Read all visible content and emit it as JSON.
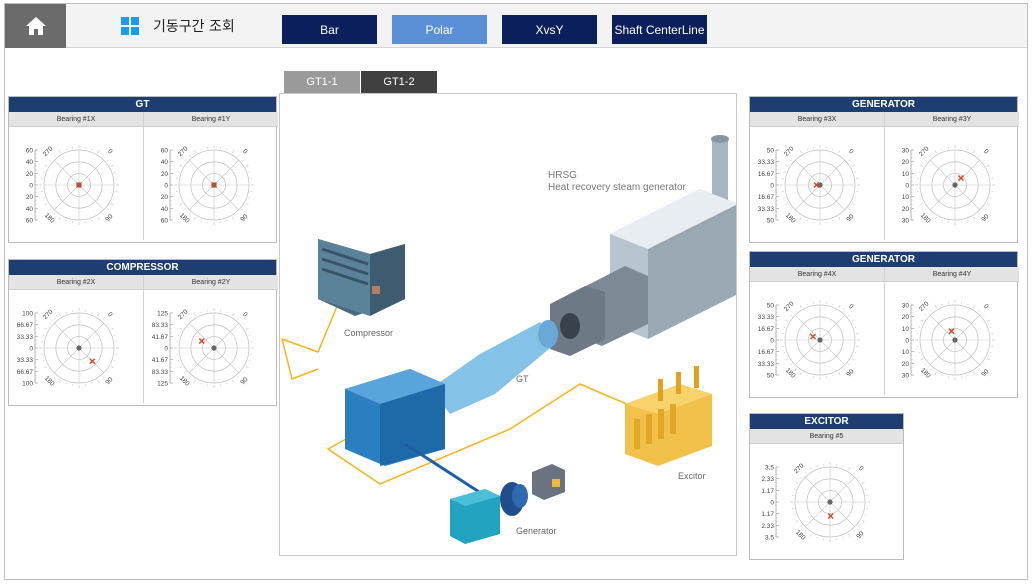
{
  "header": {
    "title": "기동구간 조회",
    "nav": [
      {
        "label": "Bar",
        "active": false
      },
      {
        "label": "Polar",
        "active": true
      },
      {
        "label": "XvsY",
        "active": false
      },
      {
        "label": "Shaft CenterLine",
        "active": false
      }
    ]
  },
  "tabs": [
    {
      "label": "GT1-1",
      "active": false
    },
    {
      "label": "GT1-2",
      "active": true
    }
  ],
  "diagram": {
    "hrsg_label": "HRSG",
    "hrsg_sub": "Heat recovery steam generator",
    "compressor_label": "Compressor",
    "gt_label": "GT",
    "excitor_label": "Excitor",
    "generator_label": "Generator"
  },
  "panels": {
    "gt": {
      "title": "GT",
      "bearings": [
        {
          "label": "Bearing #1X",
          "axis": [
            "60",
            "40",
            "20",
            "0",
            "20",
            "40",
            "60"
          ],
          "marker": [
            0.0,
            0.0
          ]
        },
        {
          "label": "Bearing #1Y",
          "axis": [
            "60",
            "40",
            "20",
            "0",
            "20",
            "40",
            "60"
          ],
          "marker": [
            0.0,
            0.0
          ]
        }
      ]
    },
    "compressor": {
      "title": "COMPRESSOR",
      "bearings": [
        {
          "label": "Bearing #2X",
          "axis": [
            "100",
            "66.67",
            "33.33",
            "0",
            "33.33",
            "66.67",
            "100"
          ],
          "marker": [
            0.38,
            0.38
          ]
        },
        {
          "label": "Bearing #2Y",
          "axis": [
            "125",
            "83.33",
            "41.67",
            "0",
            "41.67",
            "83.33",
            "125"
          ],
          "marker": [
            -0.35,
            -0.2
          ]
        }
      ]
    },
    "generator1": {
      "title": "GENERATOR",
      "bearings": [
        {
          "label": "Bearing #3X",
          "axis": [
            "50",
            "33.33",
            "16.67",
            "0",
            "16.67",
            "33.33",
            "50"
          ],
          "marker": [
            -0.1,
            0.0
          ]
        },
        {
          "label": "Bearing #3Y",
          "axis": [
            "30",
            "20",
            "10",
            "0",
            "10",
            "20",
            "30"
          ],
          "marker": [
            0.17,
            -0.2
          ]
        }
      ]
    },
    "generator2": {
      "title": "GENERATOR",
      "bearings": [
        {
          "label": "Bearing #4X",
          "axis": [
            "50",
            "33.33",
            "16.67",
            "0",
            "16.67",
            "33.33",
            "50"
          ],
          "marker": [
            -0.2,
            -0.1
          ]
        },
        {
          "label": "Bearing #4Y",
          "axis": [
            "30",
            "20",
            "10",
            "0",
            "10",
            "20",
            "30"
          ],
          "marker": [
            -0.1,
            -0.25
          ]
        }
      ]
    },
    "excitor": {
      "title": "EXCITOR",
      "bearings": [
        {
          "label": "Bearing #5",
          "axis": [
            "3.5",
            "2.33",
            "1.17",
            "0",
            "1.17",
            "2.33",
            "3.5"
          ],
          "marker": [
            0.02,
            0.4
          ]
        }
      ]
    }
  },
  "polar_labels": {
    "top": "0",
    "left": "270",
    "right": "90",
    "bottom_left": "180",
    "bottom_right": "90"
  },
  "colors": {
    "nav_dark": "#0b1f5c",
    "nav_active": "#5b8fd5",
    "panel_head": "#1e3e72",
    "marker": "#d9461d",
    "accent_line": "#f5b41e"
  }
}
